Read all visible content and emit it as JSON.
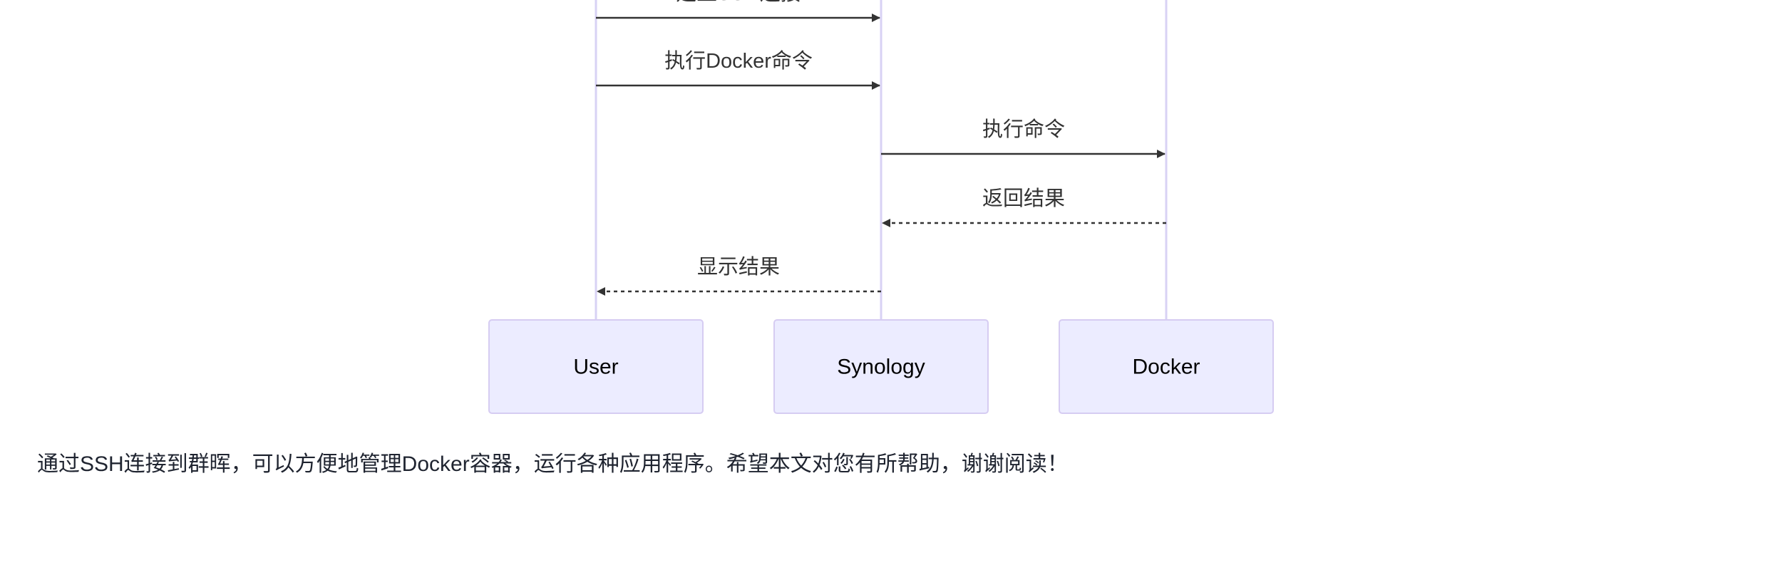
{
  "diagram": {
    "actors": [
      "User",
      "Synology",
      "Docker"
    ],
    "messages": [
      {
        "from": 0,
        "to": 1,
        "label": "建立SSH连接",
        "style": "solid"
      },
      {
        "from": 0,
        "to": 1,
        "label": "执行Docker命令",
        "style": "solid"
      },
      {
        "from": 1,
        "to": 2,
        "label": "执行命令",
        "style": "solid"
      },
      {
        "from": 2,
        "to": 1,
        "label": "返回结果",
        "style": "dashed"
      },
      {
        "from": 1,
        "to": 0,
        "label": "显示结果",
        "style": "dashed"
      }
    ],
    "colors": {
      "lifeline": "#d8d2f4",
      "box_fill": "#ececff",
      "box_stroke": "#d6ccf2",
      "arrow": "#333333"
    }
  },
  "caption": "通过SSH连接到群晖，可以方便地管理Docker容器，运行各种应用程序。希望本文对您有所帮助，谢谢阅读！"
}
